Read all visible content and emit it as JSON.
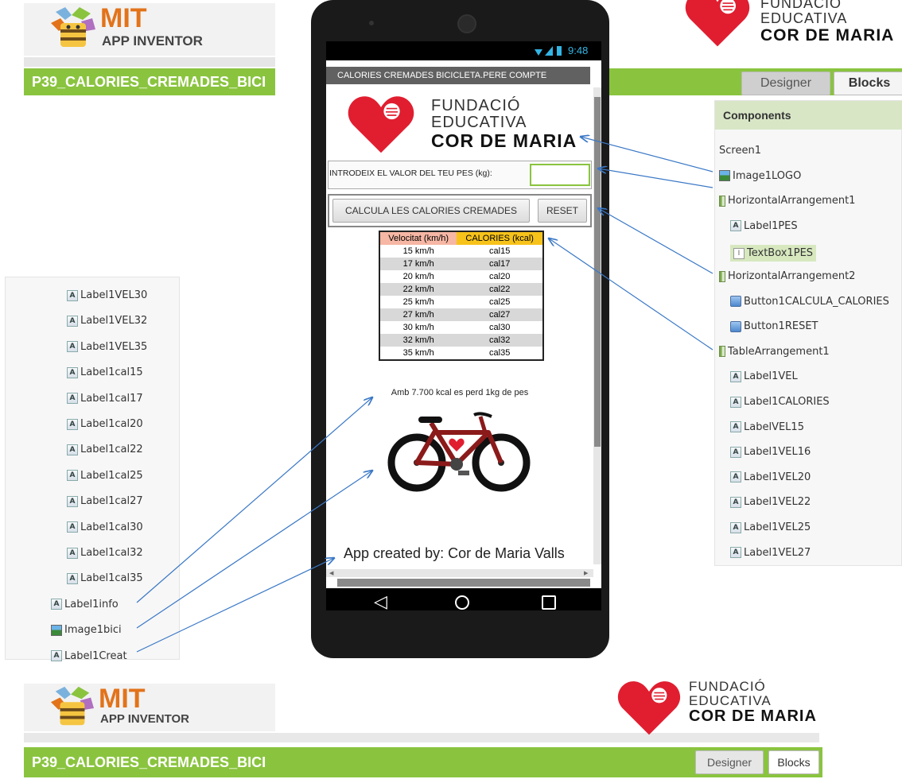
{
  "mit": {
    "name": "MIT",
    "sub": "APP INVENTOR"
  },
  "project": {
    "name": "P39_CALORIES_CREMADES_BICI"
  },
  "fundacio": {
    "line1": "FUNDACIÓ",
    "line2": "EDUCATIVA",
    "line3": "COR DE MARIA"
  },
  "tabs": {
    "designer": "Designer",
    "blocks": "Blocks"
  },
  "components": {
    "title": "Components",
    "items": [
      {
        "label": "Screen1",
        "icon": "none"
      },
      {
        "label": "Image1LOGO",
        "icon": "image-icon"
      },
      {
        "label": "HorizontalArrangement1",
        "icon": "arrangement-icon"
      },
      {
        "label": "Label1PES",
        "icon": "label-icon"
      },
      {
        "label": "TextBox1PES",
        "icon": "textbox-icon"
      },
      {
        "label": "HorizontalArrangement2",
        "icon": "arrangement-icon"
      },
      {
        "label": "Button1CALCULA_CALORIES",
        "icon": "button-icon"
      },
      {
        "label": "Button1RESET",
        "icon": "button-icon"
      },
      {
        "label": "TableArrangement1",
        "icon": "arrangement-icon"
      },
      {
        "label": "Label1VEL",
        "icon": "label-icon"
      },
      {
        "label": "Label1CALORIES",
        "icon": "label-icon"
      },
      {
        "label": "LabelVEL15",
        "icon": "label-icon"
      },
      {
        "label": "Label1VEL16",
        "icon": "label-icon"
      },
      {
        "label": "Label1VEL20",
        "icon": "label-icon"
      },
      {
        "label": "Label1VEL22",
        "icon": "label-icon"
      },
      {
        "label": "Label1VEL25",
        "icon": "label-icon"
      },
      {
        "label": "Label1VEL27",
        "icon": "label-icon"
      }
    ]
  },
  "left_components": {
    "items": [
      {
        "label": "Label1VEL30",
        "icon": "label-icon"
      },
      {
        "label": "Label1VEL32",
        "icon": "label-icon"
      },
      {
        "label": "Label1VEL35",
        "icon": "label-icon"
      },
      {
        "label": "Label1cal15",
        "icon": "label-icon"
      },
      {
        "label": "Label1cal17",
        "icon": "label-icon"
      },
      {
        "label": "Label1cal20",
        "icon": "label-icon"
      },
      {
        "label": "Label1cal22",
        "icon": "label-icon"
      },
      {
        "label": "Label1cal25",
        "icon": "label-icon"
      },
      {
        "label": "Label1cal27",
        "icon": "label-icon"
      },
      {
        "label": "Label1cal30",
        "icon": "label-icon"
      },
      {
        "label": "Label1cal32",
        "icon": "label-icon"
      },
      {
        "label": "Label1cal35",
        "icon": "label-icon"
      },
      {
        "label": "Label1info",
        "icon": "label-icon"
      },
      {
        "label": "Image1bici",
        "icon": "image-icon"
      },
      {
        "label": "Label1Creat",
        "icon": "label-icon"
      }
    ]
  },
  "phone": {
    "time": "9:48",
    "app_title": "CALORIES CREMADES BICICLETA.PERE COMPTE",
    "weight_label": "INTRODEIX EL VALOR DEL TEU PES (kg):",
    "weight_value": "",
    "calc_button": "CALCULA LES CALORIES CREMADES",
    "reset_button": "RESET",
    "table_header": [
      "Velocitat (km/h)",
      "CALORIES (kcal)"
    ],
    "table_rows": [
      [
        "15 km/h",
        "cal15"
      ],
      [
        "17 km/h",
        "cal17"
      ],
      [
        "20 km/h",
        "cal20"
      ],
      [
        "22 km/h",
        "cal22"
      ],
      [
        "25 km/h",
        "cal25"
      ],
      [
        "27 km/h",
        "cal27"
      ],
      [
        "30 km/h",
        "cal30"
      ],
      [
        "32 km/h",
        "cal32"
      ],
      [
        "35 km/h",
        "cal35"
      ]
    ],
    "info": "Amb 7.700 kcal es perd 1kg de pes",
    "credit": "App created by: Cor de Maria Valls"
  },
  "colors": {
    "green": "#8ac43f",
    "heart_red": "#e01e30",
    "mit_orange": "#e2731a",
    "vel_header": "#f6b7a4",
    "cal_header": "#f7c31a",
    "arrow_blue": "#3a78c6"
  }
}
